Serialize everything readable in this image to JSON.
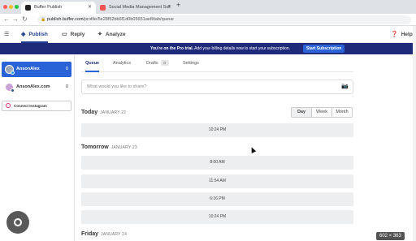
{
  "browser": {
    "tabs": [
      {
        "title": "Buffer Publish",
        "active": true
      },
      {
        "title": "Social Media Management Sof",
        "active": false
      }
    ],
    "url_host": "publish.buffer.com",
    "url_path": "/profile/5e28f52bb6f1d0b05651ae8/tab/queue"
  },
  "app_nav": {
    "items": [
      {
        "label": "Publish",
        "icon": "layers-icon",
        "active": true
      },
      {
        "label": "Reply",
        "icon": "reply-icon",
        "active": false
      },
      {
        "label": "Analyze",
        "icon": "analyze-icon",
        "active": false
      }
    ],
    "help_label": "Help"
  },
  "trial_banner": {
    "message_bold": "You're on the Pro trial.",
    "message": " Add your billing details now to start your subscription.",
    "cta": "Start Subscription"
  },
  "sidebar": {
    "accounts": [
      {
        "name": "AnsonAlex",
        "count": "0",
        "selected": true,
        "network_color": "#1da1f2"
      },
      {
        "name": "AnsonAlex.com",
        "count": "0",
        "selected": false,
        "network_color": "#3b5998"
      }
    ],
    "connect_label": "Connect Instagram"
  },
  "main_tabs": [
    {
      "label": "Queue",
      "active": true
    },
    {
      "label": "Analytics",
      "active": false
    },
    {
      "label": "Drafts",
      "badge": "0",
      "active": false
    },
    {
      "label": "Settings",
      "active": false
    }
  ],
  "composer": {
    "placeholder": "What would you like to share?"
  },
  "view_toggle": {
    "options": [
      "Day",
      "Week",
      "Month"
    ],
    "active": "Day"
  },
  "schedule": [
    {
      "day": "Today",
      "date": "JANUARY 22",
      "slots": [
        "10:24 PM"
      ]
    },
    {
      "day": "Tomorrow",
      "date": "JANUARY 23",
      "slots": [
        "8:00 AM",
        "11:54 AM",
        "6:16 PM",
        "10:24 PM"
      ]
    },
    {
      "day": "Friday",
      "date": "JANUARY 24",
      "slots": []
    }
  ],
  "overlay": {
    "dimensions_label": "602 × 363"
  },
  "colors": {
    "brand_navy": "#1f2b7a",
    "accent_blue": "#2a62d8"
  }
}
